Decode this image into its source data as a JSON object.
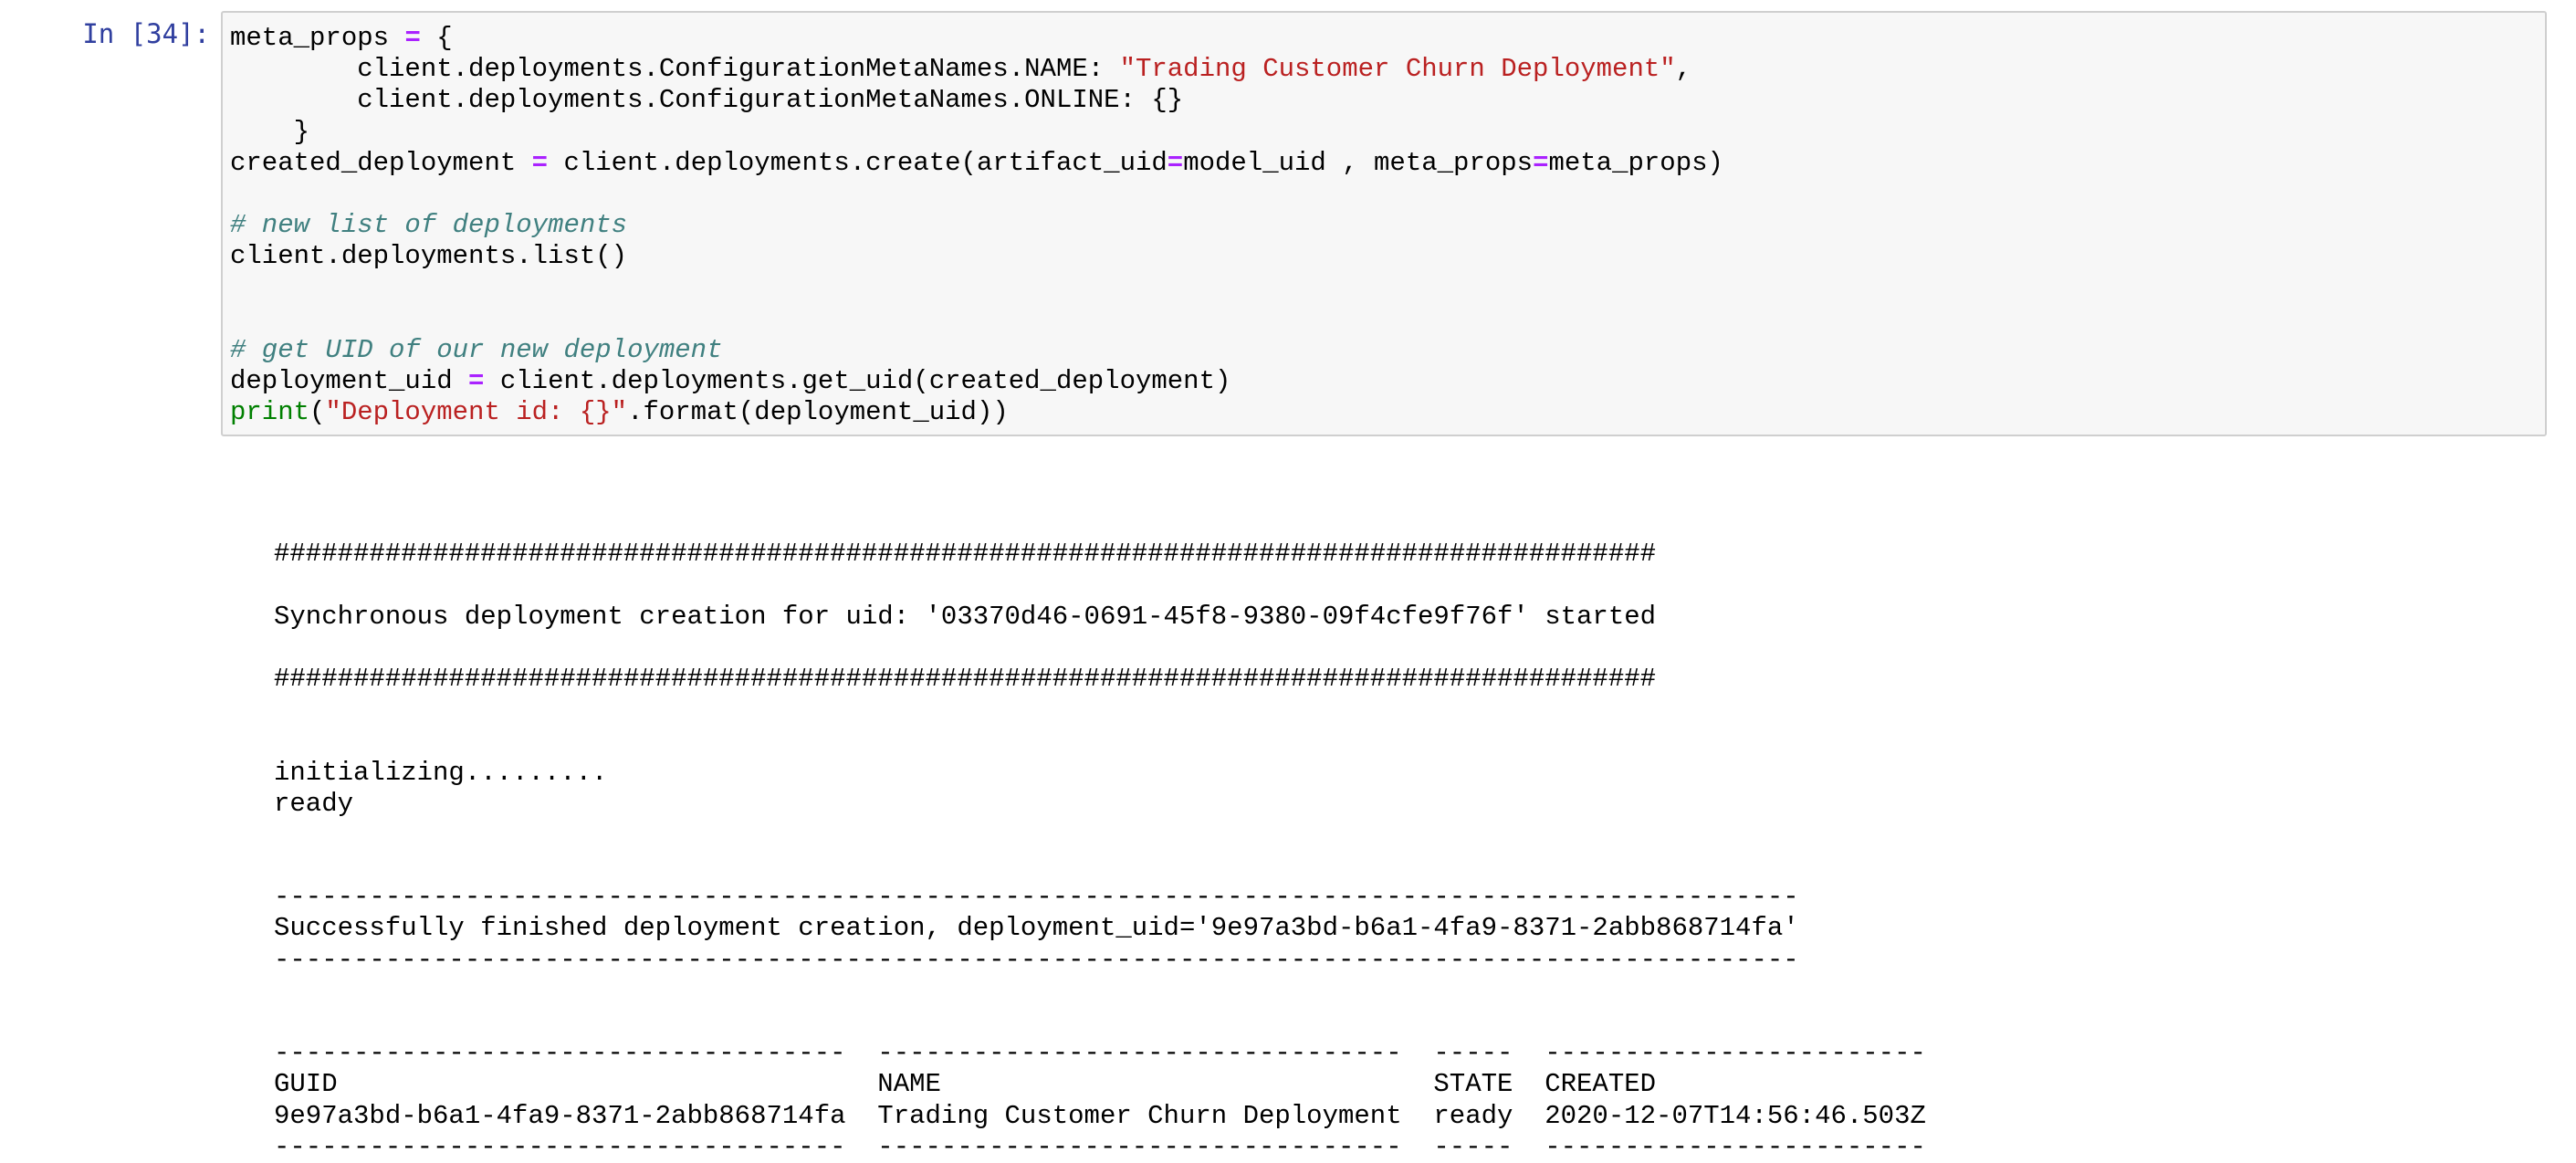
{
  "cell": {
    "prompt": "In [34]:",
    "code_lines": [
      [
        {
          "t": "meta_props "
        },
        {
          "t": "=",
          "c": "op"
        },
        {
          "t": " {"
        }
      ],
      [
        {
          "t": "        client.deployments.ConfigurationMetaNames.NAME: "
        },
        {
          "t": "\"Trading Customer Churn Deployment\"",
          "c": "st"
        },
        {
          "t": ","
        }
      ],
      [
        {
          "t": "        client.deployments.ConfigurationMetaNames.ONLINE: {}"
        }
      ],
      [
        {
          "t": "    }"
        }
      ],
      [
        {
          "t": "created_deployment "
        },
        {
          "t": "=",
          "c": "op"
        },
        {
          "t": " client.deployments.create(artifact_uid"
        },
        {
          "t": "=",
          "c": "op"
        },
        {
          "t": "model_uid , meta_props"
        },
        {
          "t": "=",
          "c": "op"
        },
        {
          "t": "meta_props)"
        }
      ],
      [],
      [
        {
          "t": "# new list of deployments",
          "c": "cm"
        }
      ],
      [
        {
          "t": "client.deployments.list()"
        }
      ],
      [],
      [],
      [
        {
          "t": "# get UID of our new deployment",
          "c": "cm"
        }
      ],
      [
        {
          "t": "deployment_uid "
        },
        {
          "t": "=",
          "c": "op"
        },
        {
          "t": " client.deployments.get_uid(created_deployment)"
        }
      ],
      [
        {
          "t": "print",
          "c": "bi"
        },
        {
          "t": "("
        },
        {
          "t": "\"Deployment id: {}\"",
          "c": "st"
        },
        {
          "t": ".format(deployment_uid))"
        }
      ]
    ]
  },
  "output": {
    "lines": [
      "",
      "#######################################################################################",
      "",
      "Synchronous deployment creation for uid: '03370d46-0691-45f8-9380-09f4cfe9f76f' started",
      "",
      "#######################################################################################",
      "",
      "",
      "initializing.........",
      "ready",
      "",
      "",
      "------------------------------------------------------------------------------------------------",
      "Successfully finished deployment creation, deployment_uid='9e97a3bd-b6a1-4fa9-8371-2abb868714fa'",
      "------------------------------------------------------------------------------------------------",
      "",
      "",
      "------------------------------------  ---------------------------------  -----  ------------------------",
      "GUID                                  NAME                               STATE  CREATED",
      "9e97a3bd-b6a1-4fa9-8371-2abb868714fa  Trading Customer Churn Deployment  ready  2020-12-07T14:56:46.503Z",
      "------------------------------------  ---------------------------------  -----  ------------------------"
    ]
  },
  "colors": {
    "prompt": "#303f9f",
    "comment": "#408080",
    "string": "#ba2121",
    "operator": "#aa22ff",
    "builtin": "#008000",
    "cell_background": "#f7f7f7",
    "cell_border": "#cfcfcf"
  }
}
